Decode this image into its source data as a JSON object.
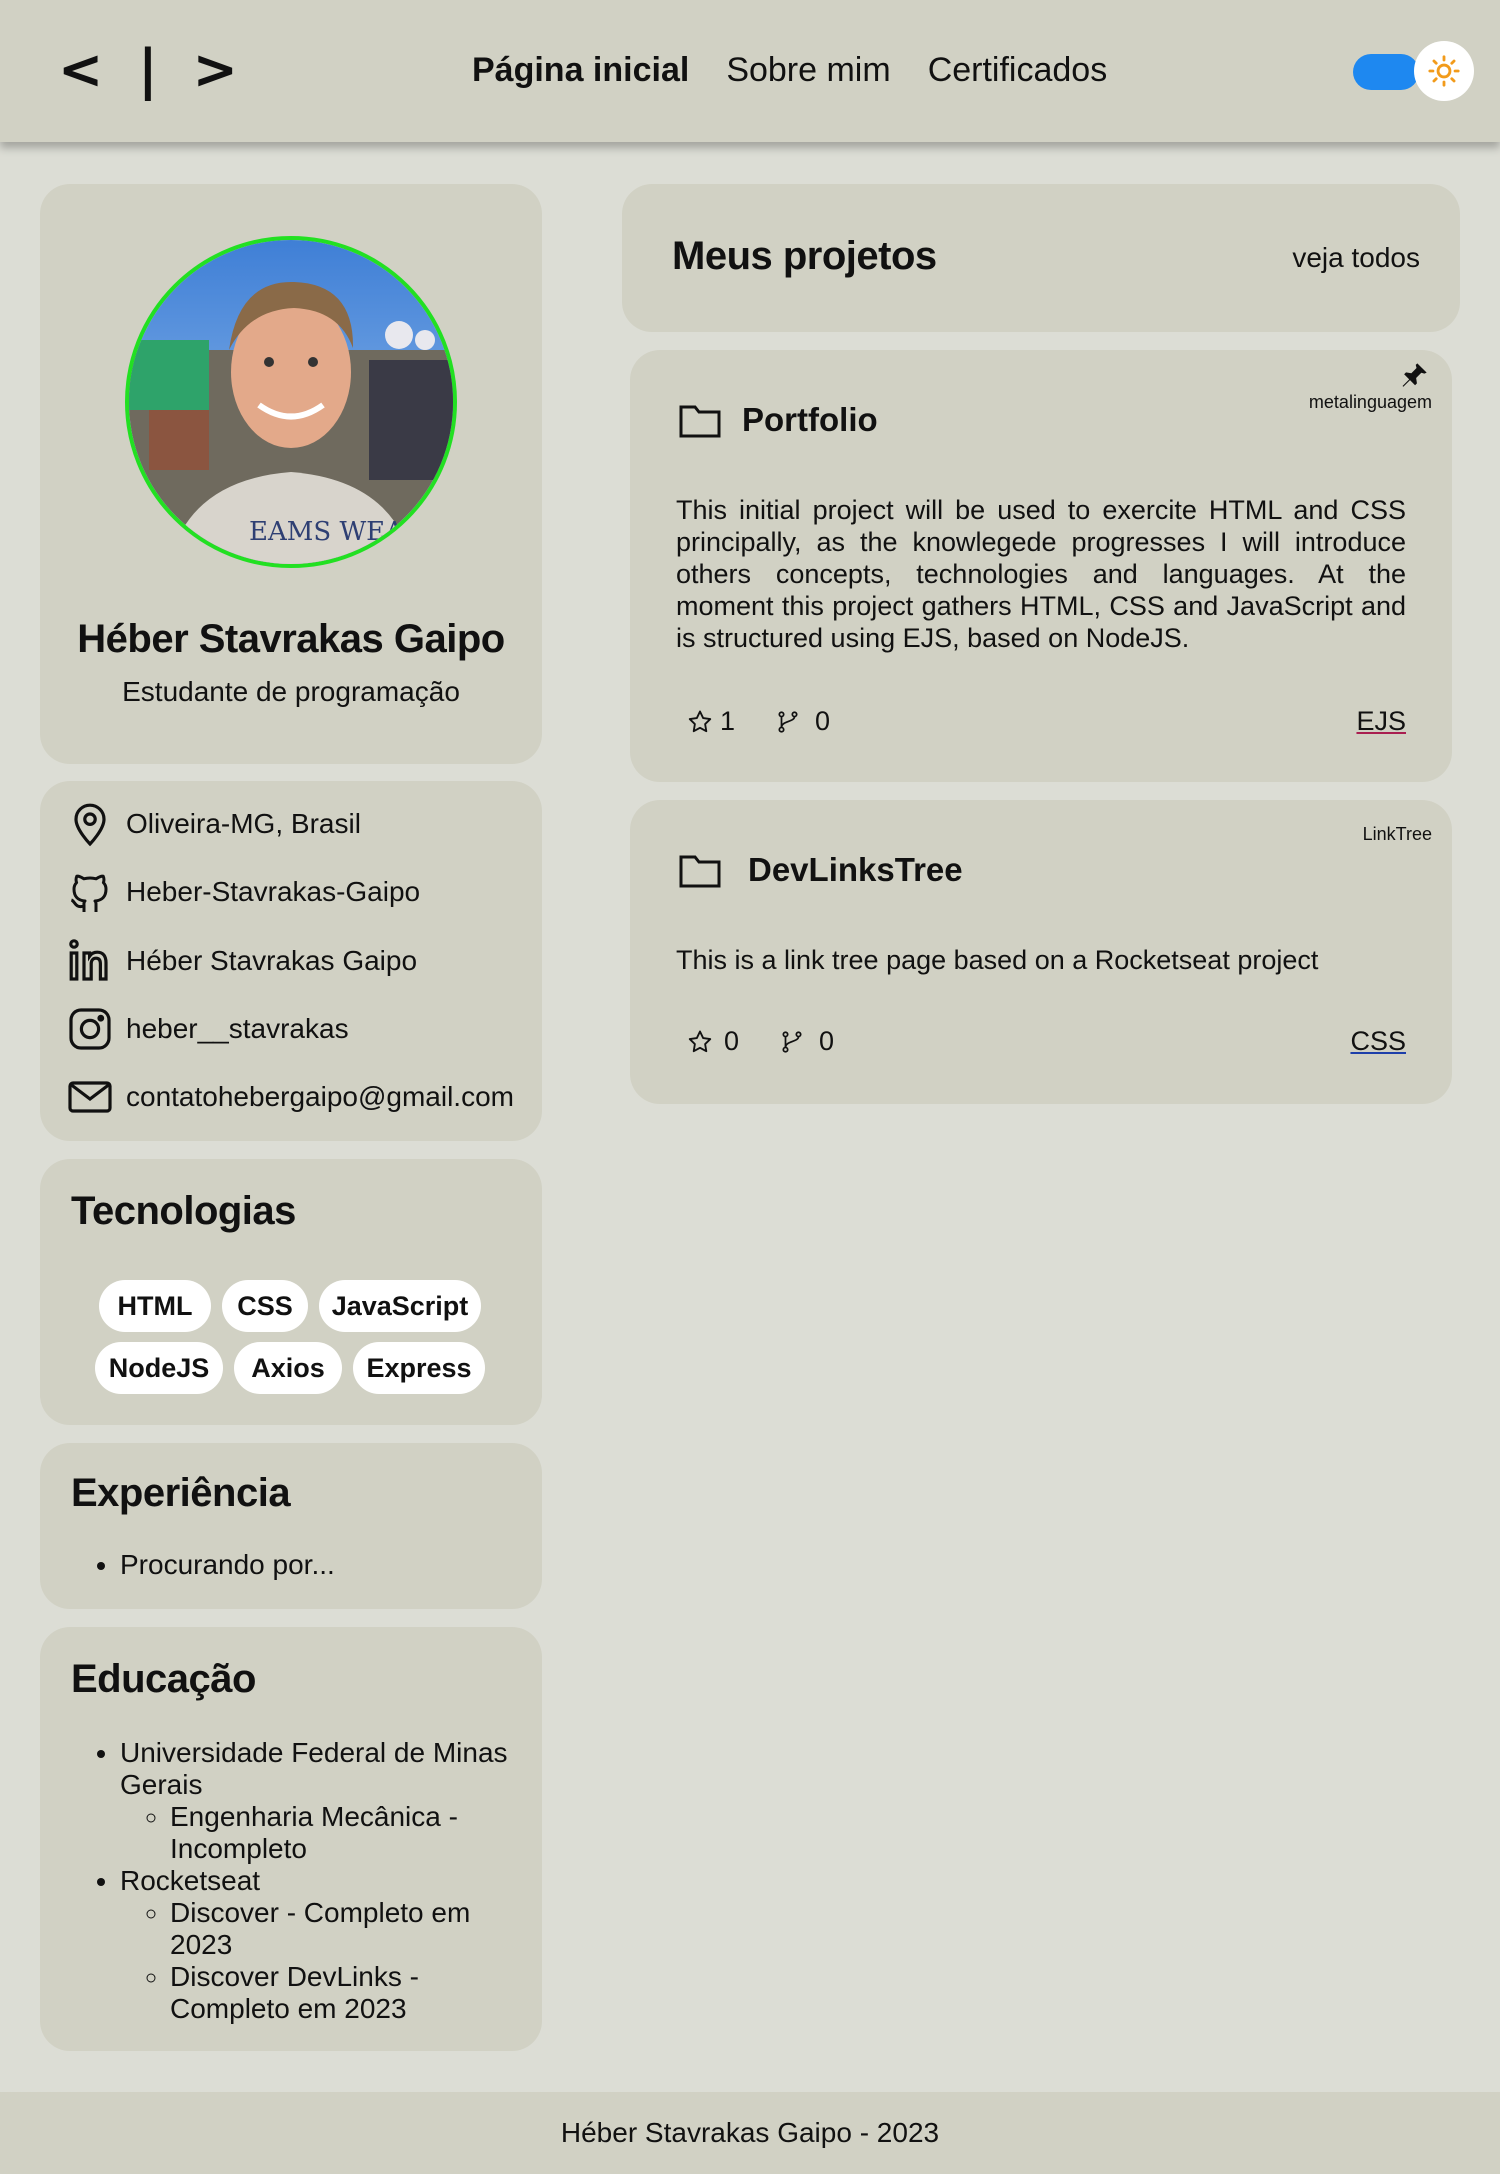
{
  "header": {
    "logo": "< | >",
    "nav": [
      "Página inicial",
      "Sobre mim",
      "Certificados"
    ],
    "theme_toggle": "light"
  },
  "profile": {
    "name": "Héber Stavrakas Gaipo",
    "role": "Estudante de programação",
    "contacts": [
      {
        "icon": "location-pin-icon",
        "text": "Oliveira-MG, Brasil"
      },
      {
        "icon": "github-icon",
        "text": "Heber-Stavrakas-Gaipo"
      },
      {
        "icon": "linkedin-icon",
        "text": "Héber Stavrakas Gaipo"
      },
      {
        "icon": "instagram-icon",
        "text": "heber__stavrakas"
      },
      {
        "icon": "mail-icon",
        "text": "contatohebergaipo@gmail.com"
      }
    ]
  },
  "technologies": {
    "title": "Tecnologias",
    "items": [
      "HTML",
      "CSS",
      "JavaScript",
      "NodeJS",
      "Axios",
      "Express"
    ]
  },
  "experience": {
    "title": "Experiência",
    "items": [
      "Procurando por..."
    ]
  },
  "education": {
    "title": "Educação",
    "items": [
      {
        "name": "Universidade Federal de Minas Gerais",
        "sub": [
          "Engenharia Mecânica - Incompleto"
        ]
      },
      {
        "name": "Rocketseat",
        "sub": [
          "Discover - Completo em 2023",
          "Discover DevLinks - Completo em 2023"
        ]
      }
    ]
  },
  "projects": {
    "title": "Meus projetos",
    "see_all": "veja todos",
    "repos": [
      {
        "name": "Portfolio",
        "tag": "metalinguagem",
        "pinned": true,
        "description": "This initial project will be used to exercite HTML and CSS principally, as the knowlegede progresses I will introduce others concepts, technologies and languages. At the moment this project gathers HTML, CSS and JavaScript and is structured using EJS, based on NodeJS.",
        "stars": "1",
        "forks": "0",
        "language": "EJS",
        "language_color": "#a91e50"
      },
      {
        "name": "DevLinksTree",
        "tag": "LinkTree",
        "pinned": false,
        "description": "This is a link tree page based on a Rocketseat project",
        "stars": "0",
        "forks": "0",
        "language": "CSS",
        "language_color": "#563d7c"
      }
    ]
  },
  "footer": {
    "text": "Héber Stavrakas Gaipo - 2023"
  },
  "colors": {
    "accent_toggle": "#1e88f0",
    "avatar_ring": "#22e022",
    "card_bg": "#d1d1c4",
    "page_bg": "#dcddd5"
  }
}
